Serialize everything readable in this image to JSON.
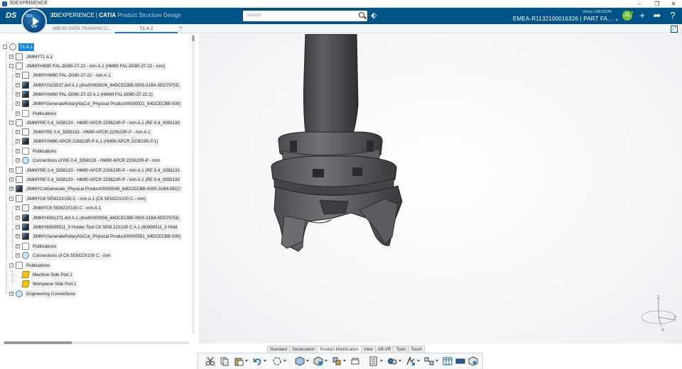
{
  "window": {
    "title": "3DEXPERIENCE",
    "minimize_glyph": "–",
    "restore_glyph": "❐",
    "close_glyph": "✕"
  },
  "header": {
    "brand_3d": "3D",
    "brand_experience": "EXPERIENCE",
    "brand_separator": " | ",
    "brand_catia": "CATIA",
    "brand_app": "Product Structure Design",
    "compass_version": "V.R",
    "compass_ds": "3DS",
    "logo_glyph": "DS",
    "search_placeholder": "Search",
    "user_name": "Jimmy CRESSON",
    "part_info": "EMEA-R1132100016326 | PART FA... ⌄",
    "avatar_initials": "JC",
    "colors": {
      "header_bg": "#005386",
      "selection": "#1c88d0",
      "accent": "#1c7fc0"
    }
  },
  "tabs": {
    "items": [
      {
        "label": "MBOM DATA TRAINING C..."
      },
      {
        "label": "T1 A.1"
      }
    ],
    "add_glyph": "+"
  },
  "tree": {
    "rows": [
      {
        "label": "T1 A.1",
        "icon": "root",
        "selected": true
      },
      {
        "label": "JIMMYT1 A.1",
        "icon": "prod"
      },
      {
        "label": "JIMMYHM90 FAL-D080-27-22 - mm A.1 (HM90 FAL-D080-27-22 - mm)",
        "icon": "prod"
      },
      {
        "label": "JIMMYHM90 FAL-D080-27-22 - mm A.1",
        "icon": "prod"
      },
      {
        "label": "JIMMY3103537.dxf A.1 (drw00000026_64DCECBB-0000-31B4-5ED7975D",
        "icon": "part"
      },
      {
        "label": "JIMMYHM90 FAL-D080-27-22 A.1 (HM90 FAL-D080-27-22.1)",
        "icon": "part"
      },
      {
        "label": "JIMMYGenerateRotaryNoCut_Physical Product00000021_64DCECBB-000(",
        "icon": "part"
      },
      {
        "label": "Publications",
        "icon": "pub"
      },
      {
        "label": "JIMMYRE 0.4_3358133 - HM90 APCR 220623R-P - mm A.1 (RE 0.4_3358133",
        "icon": "prod"
      },
      {
        "label": "JIMMYRE 0.4_3358133 - HM90 APCR 220623R-P - mm A.1",
        "icon": "prod"
      },
      {
        "label": "JIMMYHM90 APCR 220623R-P A.1 (HM90 APCR 220623R-P.1)",
        "icon": "part"
      },
      {
        "label": "Publications",
        "icon": "pub"
      },
      {
        "label": "Connections of RE 0.4_3358133 - HM90 APCR 220623R-P - mm",
        "icon": "conn"
      },
      {
        "label": "JIMMYRE 0.4_3358133 - HM90 APCR 220623R-P - mm A.1 (RE 0.4_3358133",
        "icon": "prod"
      },
      {
        "label": "JIMMYRE 0.4_3358133 - HM90 APCR 220623R-P - mm A.1 (RE 0.4_3358133",
        "icon": "prod"
      },
      {
        "label": "JIMMYCutGenerate_Physical Product00000045_64DCECBB-0000-31B4-5ED7",
        "icon": "part"
      },
      {
        "label": "JIMMYC6 SEM22X100 C - mm A.1 (C6 SEM22X100 C - mm)",
        "icon": "prod"
      },
      {
        "label": "JIMMYC6 SEM22X100 C - mm A.1",
        "icon": "prod"
      },
      {
        "label": "JIMMY4561371.dxf A.1 (drw00000056_64DCECBB-0000-31B4-5ED7975D",
        "icon": "part"
      },
      {
        "label": "JIMMY60999511_0 Holder-Tool C6 SEM 22X100 C A.1 (60999511_0 Hold",
        "icon": "part"
      },
      {
        "label": "JIMMYGenerateRotaryNoCut_Physical Product00000051_64DCECBB-000(",
        "icon": "part"
      },
      {
        "label": "Publications",
        "icon": "pub"
      },
      {
        "label": "Connections of C6 SEM22X100 C - mm",
        "icon": "conn"
      },
      {
        "label": "Publications",
        "icon": "pub"
      },
      {
        "label": "Machine Side Port.1",
        "icon": "port"
      },
      {
        "label": "Workpiece Side Port.1",
        "icon": "port"
      },
      {
        "label": "Engineering Connections",
        "icon": "conn"
      }
    ]
  },
  "viewport": {
    "compass_axes": {
      "z": "Z",
      "x": "X",
      "y": "Y"
    }
  },
  "action_bar": {
    "sections": [
      {
        "label": "Standard"
      },
      {
        "label": "Geolocation"
      },
      {
        "label": "Product Modification",
        "active": true
      },
      {
        "label": "View"
      },
      {
        "label": "AR-VR"
      },
      {
        "label": "Tools"
      },
      {
        "label": "Touch"
      }
    ],
    "commands": [
      {
        "icon": "cut-icon"
      },
      {
        "icon": "copy-icon"
      },
      {
        "icon": "paste-icon"
      },
      {
        "icon": "undo-icon"
      },
      {
        "icon": "update-icon"
      },
      {
        "icon": "insert-product-icon"
      },
      {
        "icon": "insert-existing-icon"
      },
      {
        "icon": "replace-icon"
      },
      {
        "icon": "flexible-icon"
      },
      {
        "icon": "properties-icon"
      },
      {
        "icon": "engineering-connection-icon"
      },
      {
        "icon": "snap-icon"
      },
      {
        "icon": "explode-icon"
      },
      {
        "icon": "table-icon"
      },
      {
        "icon": "filter-icon"
      },
      {
        "icon": "more-icon"
      }
    ]
  }
}
